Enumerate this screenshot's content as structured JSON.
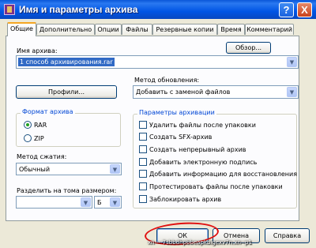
{
  "window": {
    "title": "Имя и параметры архива",
    "help": "?",
    "close": "X"
  },
  "tabs": [
    "Общие",
    "Дополнительно",
    "Опции",
    "Файлы",
    "Резервные копии",
    "Время",
    "Комментарий"
  ],
  "archive_name": {
    "label": "Имя архива:",
    "value": "1 способ архивирования.rar",
    "browse": "Обзор..."
  },
  "profiles_button": "Профили...",
  "update_method": {
    "label": "Метод обновления:",
    "value": "Добавить с заменой файлов"
  },
  "archive_format": {
    "label": "Формат архива",
    "options": [
      "RAR",
      "ZIP"
    ],
    "selected": "RAR"
  },
  "compression": {
    "label": "Метод сжатия:",
    "value": "Обычный"
  },
  "split": {
    "label": "Разделить на тома размером:",
    "size_value": "",
    "unit_value": "Б"
  },
  "archive_options": {
    "label": "Параметры архивации",
    "items": [
      "Удалить файлы после упаковки",
      "Создать SFX-архив",
      "Создать непрерывный архив",
      "Добавить электронную подпись",
      "Добавить информацию для восстановления",
      "Протестировать файлы после упаковки",
      "Заблокировать архив"
    ]
  },
  "footer": {
    "ok": "ОК",
    "cancel": "Отмена",
    "help": "Справка"
  },
  "watermark": "xn----7sbbdhpbbeapkbigexv7n.xn--p1",
  "colors": {
    "title_bar": "#0055e5",
    "tab_highlight": "#f5a623",
    "selection": "#316ac5",
    "annotation": "#e01010"
  }
}
